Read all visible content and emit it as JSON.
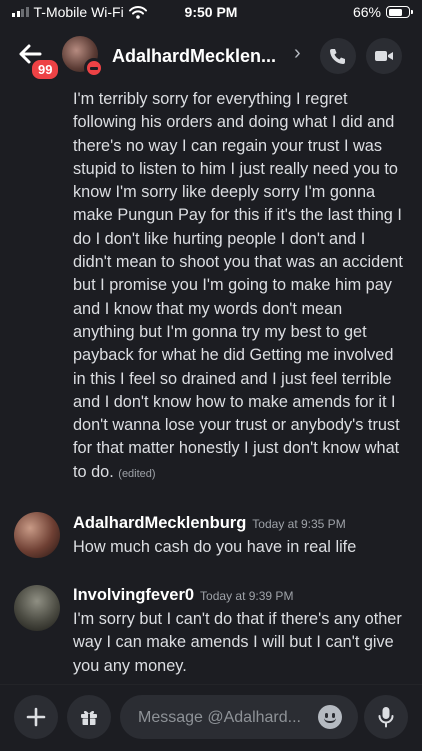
{
  "status_bar": {
    "carrier": "T-Mobile Wi-Fi",
    "time": "9:50 PM",
    "battery": "66%"
  },
  "header": {
    "title": "AdalhardMecklen...",
    "unread_badge": "99"
  },
  "messages": [
    {
      "text": "I'm terribly sorry for everything I regret following his orders and doing what I did and there's no way I can regain your trust I was stupid to listen to him I just really need you to know I'm sorry like deeply sorry I'm gonna make Pungun Pay for this if it's the last thing I do I don't like hurting people I don't and I didn't mean to shoot you that was an accident but I promise you I'm going to make him pay and I know that my words don't mean anything but I'm gonna try my best to get payback for what he did Getting me involved in this I feel so drained and I just feel terrible and I don't know how to make amends for it I don't wanna lose your trust or anybody's trust for that matter honestly I just don't know what to do.",
      "edited_label": "(edited)"
    },
    {
      "author": "AdalhardMecklenburg",
      "timestamp": "Today at 9:35 PM",
      "text": "How much cash do you have in real life"
    },
    {
      "author": "Involvingfever0",
      "timestamp": "Today at 9:39 PM",
      "text": "I'm sorry but I can't do that if there's any other way I can make amends I will but I can't give you any money."
    }
  ],
  "composer": {
    "placeholder": "Message @Adalhard..."
  }
}
